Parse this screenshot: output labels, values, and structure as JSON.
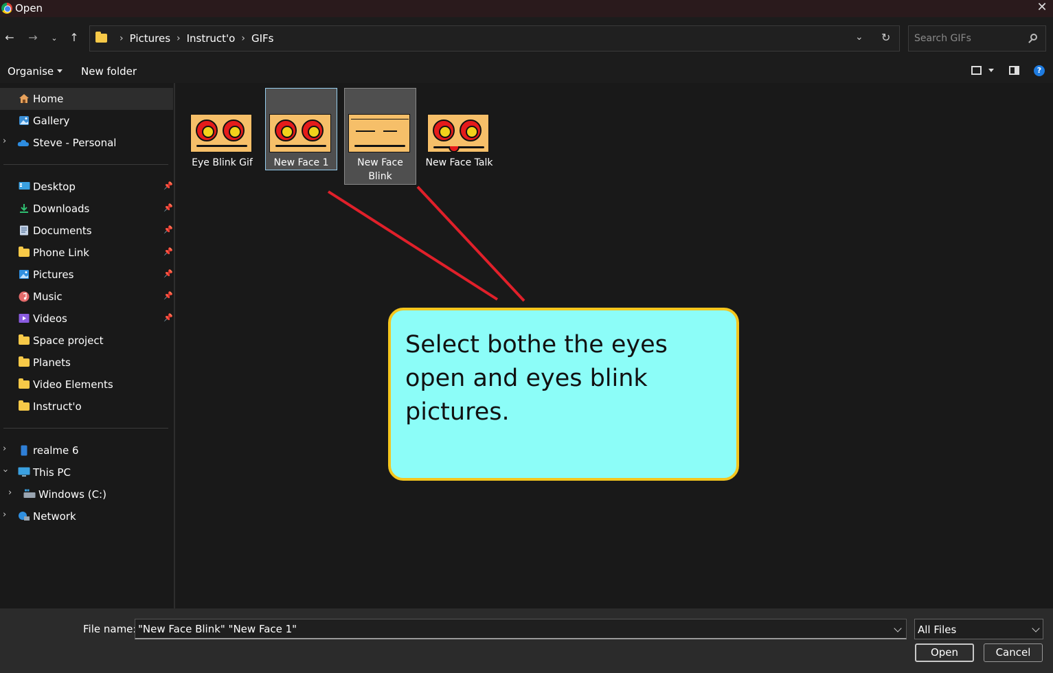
{
  "window": {
    "title": "Open"
  },
  "address": {
    "breadcrumbs": [
      "Pictures",
      "Instruct'o",
      "GIFs"
    ],
    "search_placeholder": "Search GIFs"
  },
  "toolbar": {
    "organise": "Organise",
    "new_folder": "New folder"
  },
  "sidebar": {
    "top": [
      {
        "label": "Home",
        "icon": "home-icon",
        "selected": true
      },
      {
        "label": "Gallery",
        "icon": "gallery-icon"
      },
      {
        "label": "Steve - Personal",
        "icon": "onedrive-cloud-icon",
        "expandable": true
      }
    ],
    "quick_access": [
      {
        "label": "Desktop",
        "icon": "desktop-icon",
        "pinned": true
      },
      {
        "label": "Downloads",
        "icon": "downloads-icon",
        "pinned": true
      },
      {
        "label": "Documents",
        "icon": "documents-icon",
        "pinned": true
      },
      {
        "label": "Phone Link",
        "icon": "folder-icon",
        "pinned": true
      },
      {
        "label": "Pictures",
        "icon": "pictures-icon",
        "pinned": true
      },
      {
        "label": "Music",
        "icon": "music-icon",
        "pinned": true
      },
      {
        "label": "Videos",
        "icon": "videos-icon",
        "pinned": true
      },
      {
        "label": "Space project",
        "icon": "folder-icon"
      },
      {
        "label": "Planets",
        "icon": "folder-icon"
      },
      {
        "label": "Video Elements",
        "icon": "folder-icon"
      },
      {
        "label": "Instruct'o",
        "icon": "folder-icon"
      }
    ],
    "devices": [
      {
        "label": "realme 6",
        "icon": "phone-icon",
        "expandable": true
      },
      {
        "label": "This PC",
        "icon": "pc-icon",
        "expanded": true
      },
      {
        "label": "Windows (C:)",
        "icon": "drive-icon",
        "expandable": true
      },
      {
        "label": "Network",
        "icon": "network-icon",
        "expandable": true
      }
    ]
  },
  "files": [
    {
      "name": "Eye Blink Gif",
      "state": "normal",
      "face": "eyes-open"
    },
    {
      "name": "New Face 1",
      "state": "focused",
      "face": "eyes-open"
    },
    {
      "name": "New Face Blink",
      "state": "selected",
      "face": "eyes-closed"
    },
    {
      "name": "New Face Talk",
      "state": "normal",
      "face": "eyes-open-tongue"
    }
  ],
  "callout": {
    "text": "Select bothe the eyes open and eyes blink pictures."
  },
  "bottom": {
    "file_name_label": "File name:",
    "file_name_value": "\"New Face Blink\" \"New Face 1\"",
    "file_type": "All Files",
    "open_label": "Open",
    "cancel_label": "Cancel"
  },
  "colors": {
    "annotation_arrow": "#e0202a",
    "callout_fill": "#8cfdf8",
    "callout_border": "#f4c61e"
  }
}
